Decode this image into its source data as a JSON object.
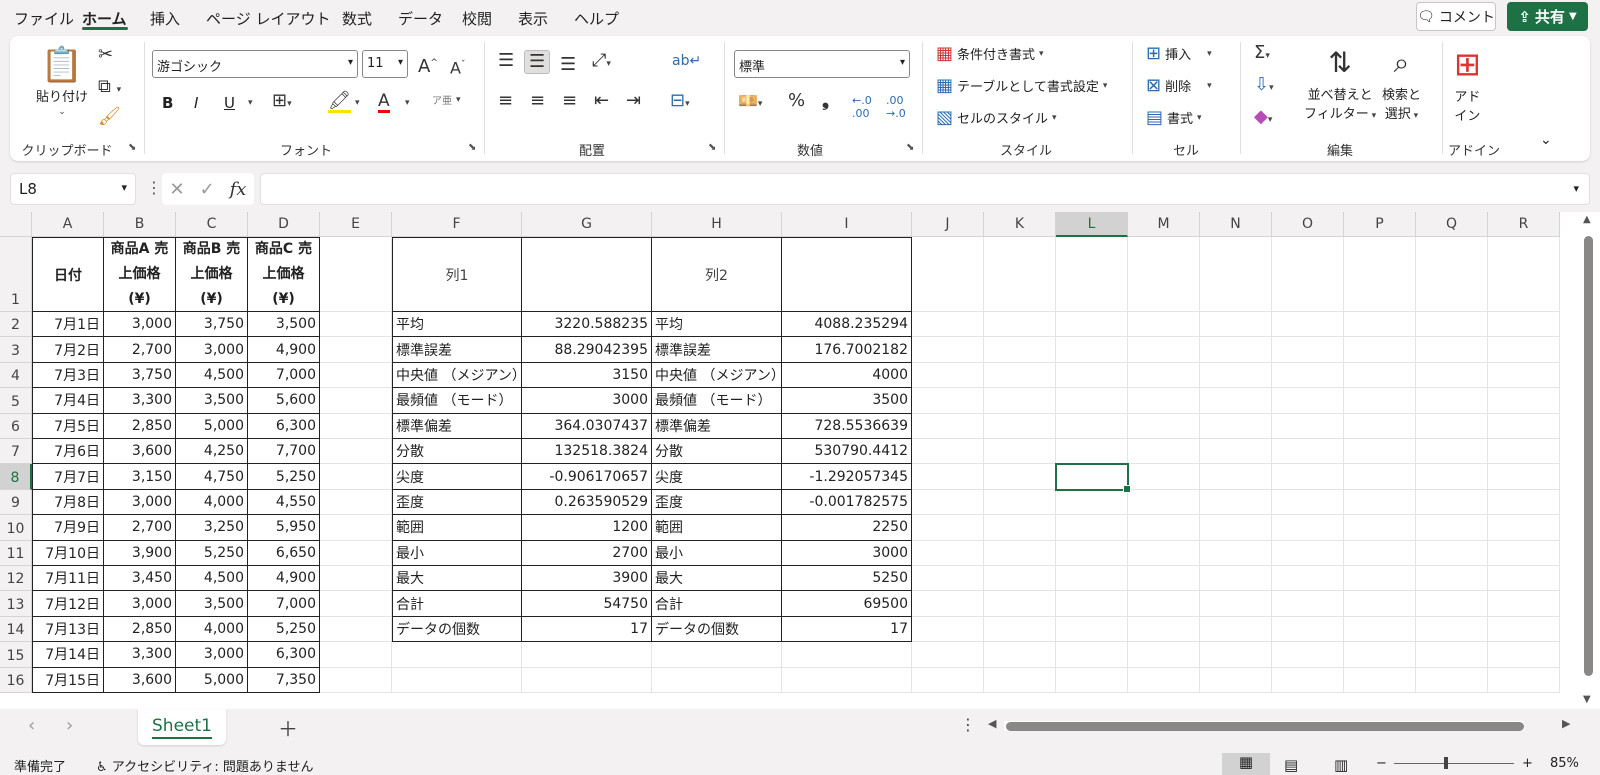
{
  "menu": {
    "items": [
      "ファイル",
      "ホーム",
      "挿入",
      "ページ レイアウト",
      "数式",
      "データ",
      "校閲",
      "表示",
      "ヘルプ"
    ],
    "comment": "コメント",
    "share": "共有"
  },
  "ribbon": {
    "clipboard": {
      "paste": "貼り付け",
      "label": "クリップボード"
    },
    "font": {
      "name": "游ゴシック",
      "size": "11",
      "bold": "B",
      "italic": "I",
      "underline": "U",
      "label": "フォント"
    },
    "alignment": {
      "label": "配置"
    },
    "number": {
      "format": "標準",
      "label": "数値"
    },
    "styles": {
      "conditional": "条件付き書式",
      "table": "テーブルとして書式設定",
      "cell_styles": "セルのスタイル",
      "label": "スタイル"
    },
    "cells": {
      "insert": "挿入",
      "delete": "削除",
      "format": "書式",
      "label": "セル"
    },
    "editing": {
      "sort": "並べ替えと",
      "sort2": "フィルター",
      "find": "検索と",
      "find2": "選択",
      "label": "編集"
    },
    "addins": {
      "addin": "アド",
      "addin2": "イン",
      "label": "アドイン"
    }
  },
  "formula_bar": {
    "name_box": "L8",
    "fx": "fx",
    "value": ""
  },
  "columns": [
    "A",
    "B",
    "C",
    "D",
    "E",
    "F",
    "G",
    "H",
    "I",
    "J",
    "K",
    "L",
    "M",
    "N",
    "O",
    "P",
    "Q",
    "R"
  ],
  "rows": [
    "1",
    "2",
    "3",
    "4",
    "5",
    "6",
    "7",
    "8",
    "9",
    "10",
    "11",
    "12",
    "13",
    "14",
    "15",
    "16"
  ],
  "header_row": {
    "a": "日付",
    "b": [
      "商品A 売",
      "上価格",
      "(¥)"
    ],
    "c": [
      "商品B 売",
      "上価格",
      "(¥)"
    ],
    "d": [
      "商品C 売",
      "上価格",
      "(¥)"
    ],
    "f": "列1",
    "h": "列2"
  },
  "table": [
    [
      "7月1日",
      "3,000",
      "3,750",
      "3,500"
    ],
    [
      "7月2日",
      "2,700",
      "3,000",
      "4,900"
    ],
    [
      "7月3日",
      "3,750",
      "4,500",
      "7,000"
    ],
    [
      "7月4日",
      "3,300",
      "3,500",
      "5,600"
    ],
    [
      "7月5日",
      "2,850",
      "5,000",
      "6,300"
    ],
    [
      "7月6日",
      "3,600",
      "4,250",
      "7,700"
    ],
    [
      "7月7日",
      "3,150",
      "4,750",
      "5,250"
    ],
    [
      "7月8日",
      "3,000",
      "4,000",
      "4,550"
    ],
    [
      "7月9日",
      "2,700",
      "3,250",
      "5,950"
    ],
    [
      "7月10日",
      "3,900",
      "5,250",
      "6,650"
    ],
    [
      "7月11日",
      "3,450",
      "4,500",
      "4,900"
    ],
    [
      "7月12日",
      "3,000",
      "3,500",
      "7,000"
    ],
    [
      "7月13日",
      "2,850",
      "4,000",
      "5,250"
    ],
    [
      "7月14日",
      "3,300",
      "3,000",
      "6,300"
    ],
    [
      "7月15日",
      "3,600",
      "5,000",
      "7,350"
    ]
  ],
  "stats": [
    [
      "平均",
      "3220.588235",
      "平均",
      "4088.235294"
    ],
    [
      "標準誤差",
      "88.29042395",
      "標準誤差",
      "176.7002182"
    ],
    [
      "中央値 （メジアン）",
      "3150",
      "中央値 （メジアン）",
      "4000"
    ],
    [
      "最頻値 （モード）",
      "3000",
      "最頻値 （モード）",
      "3500"
    ],
    [
      "標準偏差",
      "364.0307437",
      "標準偏差",
      "728.5536639"
    ],
    [
      "分散",
      "132518.3824",
      "分散",
      "530790.4412"
    ],
    [
      "尖度",
      "-0.906170657",
      "尖度",
      "-1.292057345"
    ],
    [
      "歪度",
      "0.263590529",
      "歪度",
      "-0.001782575"
    ],
    [
      "範囲",
      "1200",
      "範囲",
      "2250"
    ],
    [
      "最小",
      "2700",
      "最小",
      "3000"
    ],
    [
      "最大",
      "3900",
      "最大",
      "5250"
    ],
    [
      "合計",
      "54750",
      "合計",
      "69500"
    ],
    [
      "データの個数",
      "17",
      "データの個数",
      "17"
    ]
  ],
  "sheet": {
    "tab": "Sheet1"
  },
  "status": {
    "ready": "準備完了",
    "accessibility": "アクセシビリティ: 問題ありません",
    "zoom": "85%"
  }
}
